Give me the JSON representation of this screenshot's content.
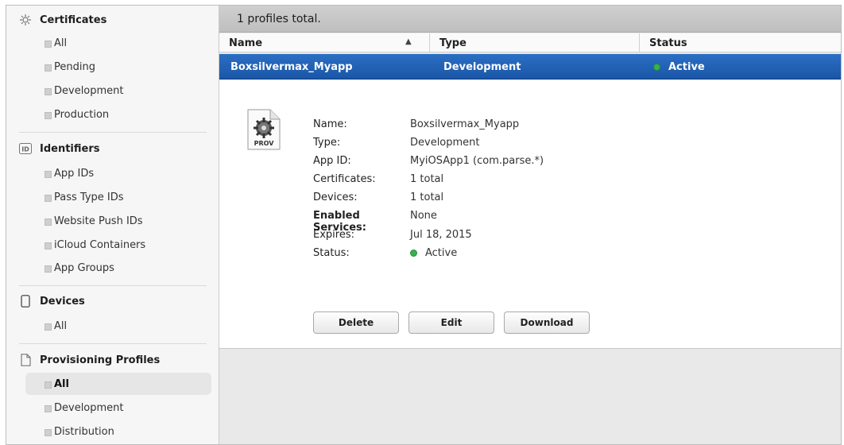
{
  "sidebar": {
    "certificates": {
      "title": "Certificates",
      "icon": "certificate-gear-icon",
      "items": [
        "All",
        "Pending",
        "Development",
        "Production"
      ]
    },
    "identifiers": {
      "title": "Identifiers",
      "icon": "id-badge-icon",
      "badge": "ID",
      "items": [
        "App IDs",
        "Pass Type IDs",
        "Website Push IDs",
        "iCloud Containers",
        "App Groups"
      ]
    },
    "devices": {
      "title": "Devices",
      "icon": "device-phone-icon",
      "items": [
        "All"
      ]
    },
    "provisioning": {
      "title": "Provisioning Profiles",
      "icon": "document-icon",
      "items": [
        "All",
        "Development",
        "Distribution"
      ],
      "selected": "All"
    }
  },
  "main": {
    "summary": "1 profiles total.",
    "columns": {
      "name": "Name",
      "type": "Type",
      "status": "Status"
    },
    "sort_indicator": "▲",
    "row": {
      "name": "Boxsilvermax_Myapp",
      "type": "Development",
      "status": "Active",
      "status_color": "#37b24d"
    },
    "detail": {
      "icon_label": "PROV",
      "fields": [
        {
          "key": "Name:",
          "value": "Boxsilvermax_Myapp"
        },
        {
          "key": "Type:",
          "value": "Development"
        },
        {
          "key": "App ID:",
          "value": "MyiOSApp1 (com.parse.*)"
        },
        {
          "key": "Certificates:",
          "value": "1 total"
        },
        {
          "key": "Devices:",
          "value": "1 total"
        },
        {
          "key": "Enabled Services:",
          "value": "None"
        },
        {
          "key": "Expires:",
          "value": "Jul 18, 2015"
        },
        {
          "key": "Status:",
          "value": "Active"
        }
      ]
    },
    "buttons": {
      "delete": "Delete",
      "edit": "Edit",
      "download": "Download"
    }
  },
  "colors": {
    "selection": "#1f5fb3",
    "active_dot": "#37b24d"
  }
}
